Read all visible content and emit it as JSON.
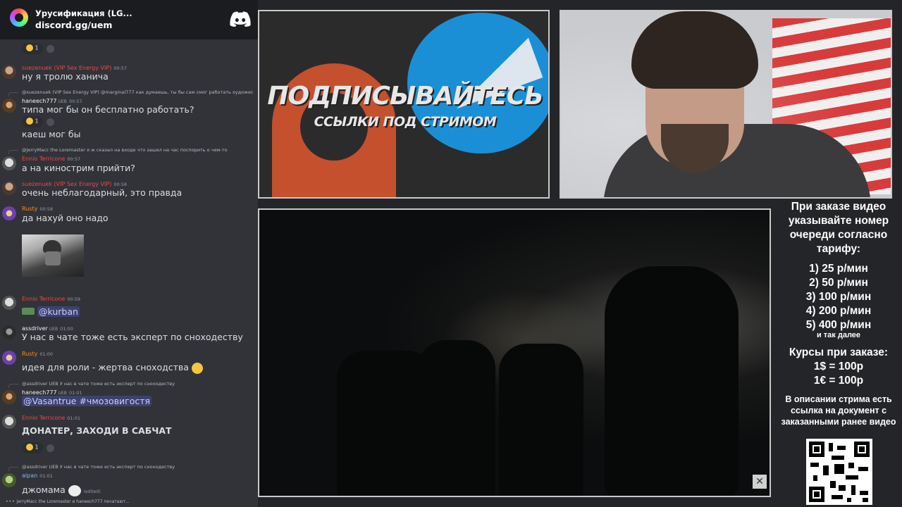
{
  "server": {
    "name": "Урусификация (LG...",
    "invite": "discord.gg/uem"
  },
  "chat": {
    "top_reaction_count": "1",
    "messages": [
      {
        "name": "suezenuek",
        "badge": "(VIP Sex Energy VIP)",
        "time": "00:57",
        "text": "ну я тролю ханича"
      },
      {
        "reply": "@suezenuek (VIP Sex Energy VIP) @marginal777 как думаешь, ты бы сам смог работать художес",
        "name": "haneech777",
        "badge": "UEB",
        "time": "00:57",
        "text": "типа мог бы он бесплатно работать?",
        "reaction": "1"
      },
      {
        "text": "каеш мог бы"
      },
      {
        "reply": "@JerryMacc the Loremaster я ж сказал на входе что зашел на час поспорить о чем-то",
        "name": "Ennio Terricone",
        "time": "00:57",
        "text": "а на кинострим прийти?"
      },
      {
        "name": "suezenuek",
        "badge": "(VIP Sex Energy VIP)",
        "time": "00:58",
        "text": "очень неблагодарный, это правда"
      },
      {
        "name": "Rusty",
        "time": "00:58",
        "text": "да нахуй оно надо"
      },
      {
        "name": "Ennio Terricone",
        "time": "00:59",
        "text": "@kurban"
      },
      {
        "name": "assdriver",
        "badge": "UEB",
        "time": "01:00",
        "text": "У нас в чате тоже есть эксперт по сноходеству"
      },
      {
        "name": "Rusty",
        "time": "01:00",
        "text": "идея для роли - жертва сноходства"
      },
      {
        "reply": "@assdriver UEB У нас в чате тоже есть эксперт по сноходеству",
        "name": "haneech777",
        "badge": "UEB",
        "time": "01:01",
        "text": "@Vasantrue #чмозовигостя"
      },
      {
        "name": "Ennio Terricone",
        "time": "01:01",
        "text": "ДОНАТЕР, ЗАХОДИ В САБЧАТ",
        "reaction": "1"
      },
      {
        "reply": "@assdriver UEB У нас в чате тоже есть эксперт по сноходеству",
        "name": "alpan",
        "time": "01:01",
        "text": "джомама",
        "edited": "(edited)"
      }
    ],
    "typing": "JerryMacc the Loremaster и haneech777 печатают..."
  },
  "promo": {
    "title": "ПОДПИСЫВАЙТЕСЬ",
    "subtitle": "ССЫЛКИ ПОД СТРИМОМ"
  },
  "order_info": {
    "heading": "При заказе видео указывайте номер очереди согласно тарифу:",
    "tariffs": [
      "1) 25 р/мин",
      "2) 50 р/мин",
      "3) 100 р/мин",
      "4) 200 р/мин",
      "5) 400 р/мин"
    ],
    "more": "и так далее",
    "rates_heading": "Курсы при заказе:",
    "rates": [
      "1$ = 100р",
      "1€ = 100р"
    ],
    "doc_note": "В описании стрима есть ссылка на документ с заказанными ранее видео"
  },
  "colors": {
    "discord_bg": "#313338",
    "header_bg": "#1b1c1f",
    "mention": "#c9cdfb",
    "name_red": "#f04747",
    "name_orange": "#ff8c1a"
  }
}
